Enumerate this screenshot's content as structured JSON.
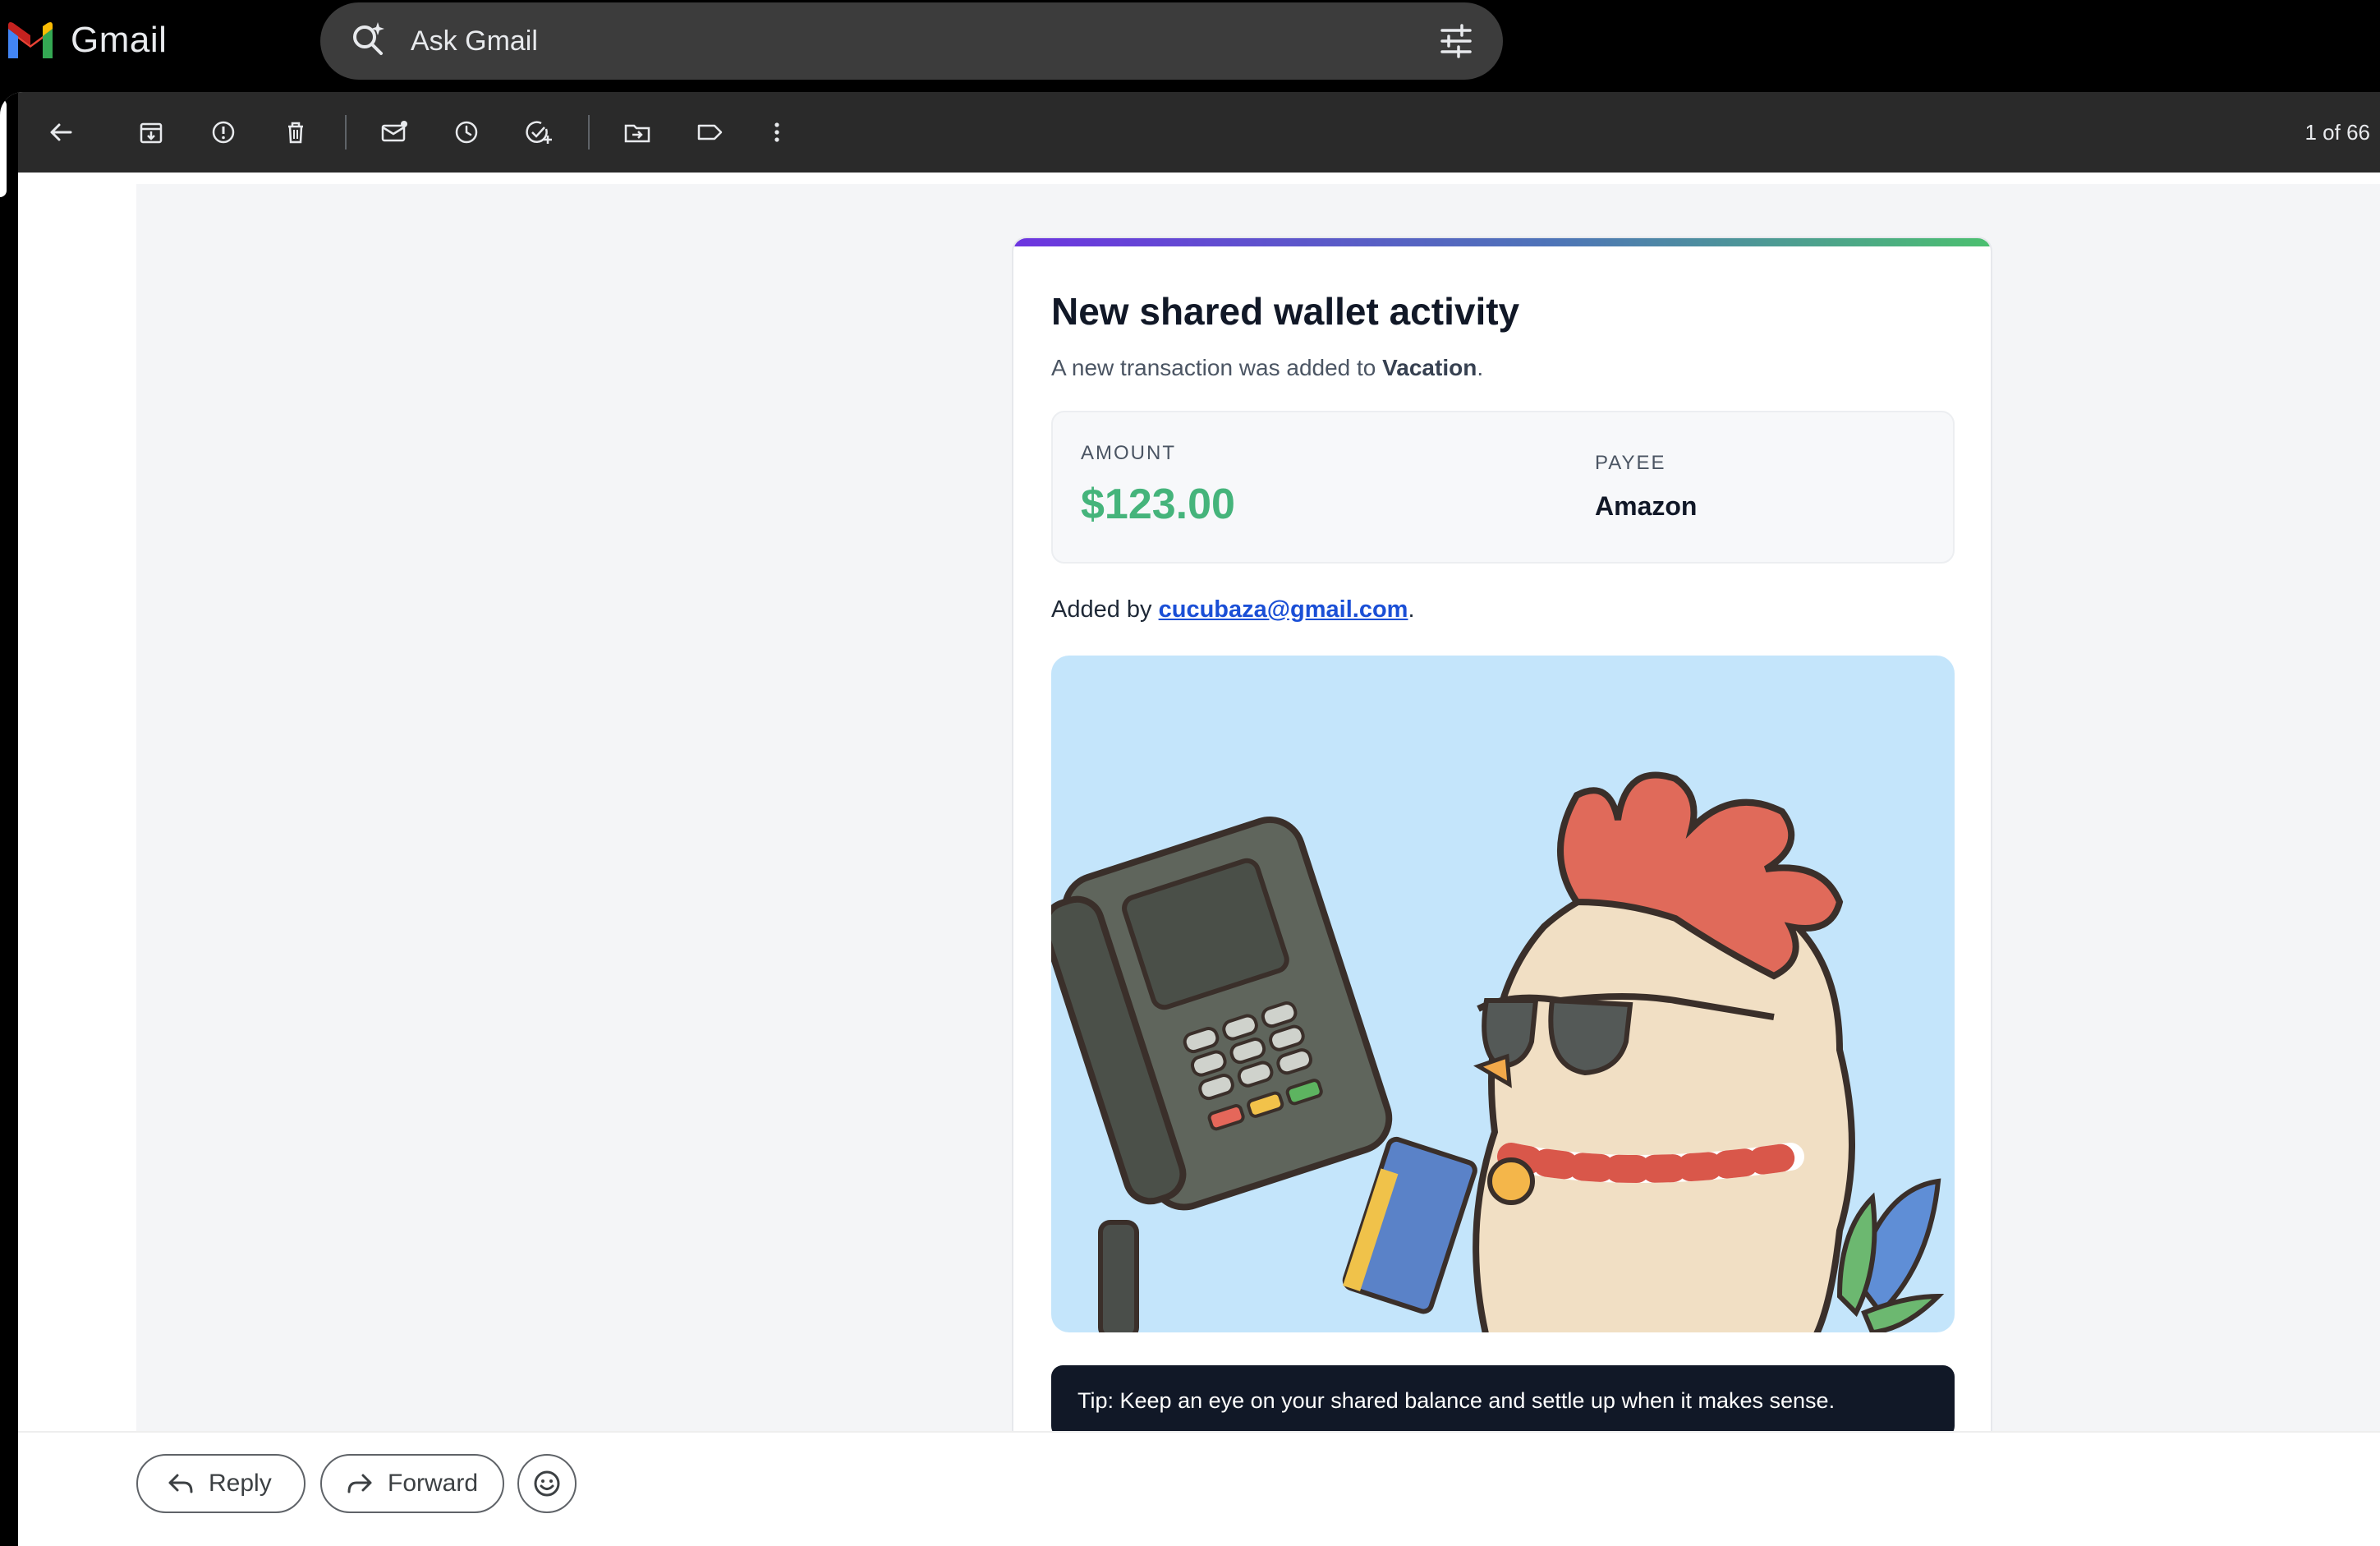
{
  "app": {
    "name": "Gmail"
  },
  "search": {
    "placeholder": "Ask Gmail"
  },
  "toolbar": {
    "icons": [
      "back-arrow-icon",
      "archive-icon",
      "report-spam-icon",
      "delete-icon",
      "mark-unread-icon",
      "snooze-icon",
      "add-task-icon",
      "move-to-icon",
      "label-icon",
      "more-vert-icon"
    ],
    "pager": "1 of 66"
  },
  "email": {
    "title": "New shared wallet activity",
    "subtitle_prefix": "A new transaction was added to ",
    "wallet_name": "Vacation",
    "subtitle_suffix": ".",
    "amount_label": "AMOUNT",
    "amount_value": "$123.00",
    "payee_label": "PAYEE",
    "payee_value": "Amazon",
    "added_by_prefix": "Added by ",
    "added_by_email": "cucubaza@gmail.com",
    "added_by_suffix": ".",
    "tip": "Tip: Keep an eye on your shared balance and settle up when it makes sense."
  },
  "actions": {
    "reply": "Reply",
    "forward": "Forward"
  },
  "colors": {
    "amount": "#45b47b",
    "link": "#1a4fd6",
    "tip_bg": "#111827",
    "illustration_bg": "#c4e5fb"
  }
}
